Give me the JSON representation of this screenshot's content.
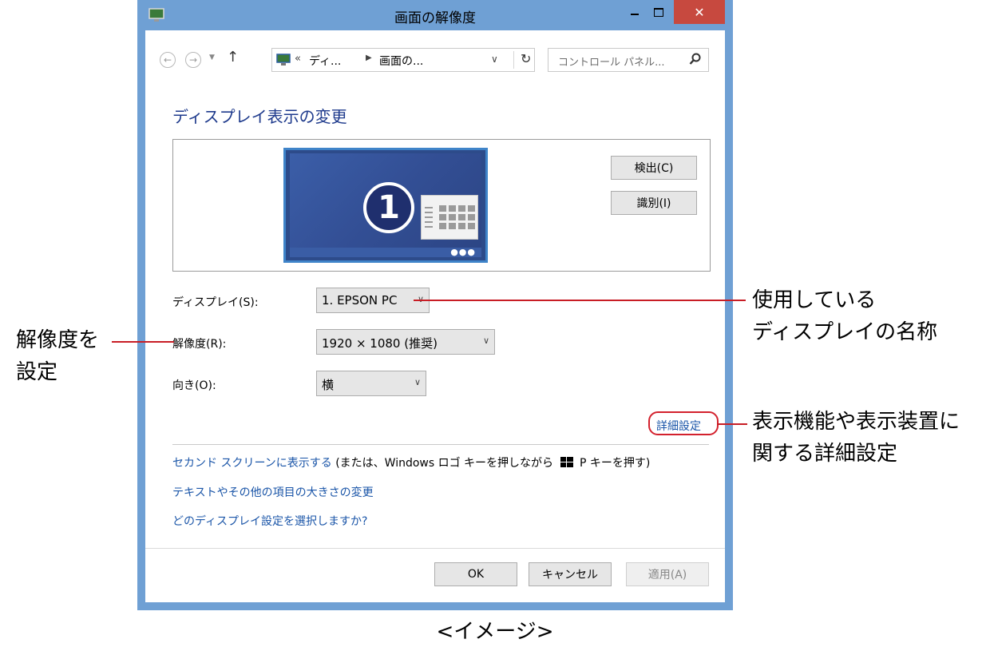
{
  "window": {
    "title": "画面の解像度"
  },
  "navigation": {
    "address_prefix": "«",
    "address_part1": "ディ...",
    "address_part2": "画面の...",
    "search_placeholder": "コントロール パネル..."
  },
  "main": {
    "section_title": "ディスプレイ表示の変更",
    "detect_button": "検出(C)",
    "identify_button": "識別(I)",
    "display_number": "1",
    "display_label": "ディスプレイ(S):",
    "display_value": "1. EPSON PC",
    "resolution_label": "解像度(R):",
    "resolution_value": "1920 × 1080 (推奨)",
    "orientation_label": "向き(O):",
    "orientation_value": "横",
    "advanced_link": "詳細設定",
    "second_screen_link": "セカンド スクリーンに表示する",
    "second_screen_note_a": "(または、Windows ロゴ キーを押しながら",
    "second_screen_note_b": "P キーを押す)",
    "text_size_link": "テキストやその他の項目の大きさの変更",
    "which_display_link": "どのディスプレイ設定を選択しますか?"
  },
  "footer": {
    "ok": "OK",
    "cancel": "キャンセル",
    "apply": "適用(A)"
  },
  "annotations": {
    "display_name_line1": "使用している",
    "display_name_line2": "ディスプレイの名称",
    "resolution_line1": "解像度を",
    "resolution_line2": "設定",
    "advanced_line1": "表示機能や表示装置に",
    "advanced_line2": "関する詳細設定"
  },
  "caption": "<イメージ>",
  "colors": {
    "frame": "#6fa0d4",
    "close_button": "#c7493f",
    "link": "#1a55a8",
    "annotation_line": "#c81d25"
  }
}
